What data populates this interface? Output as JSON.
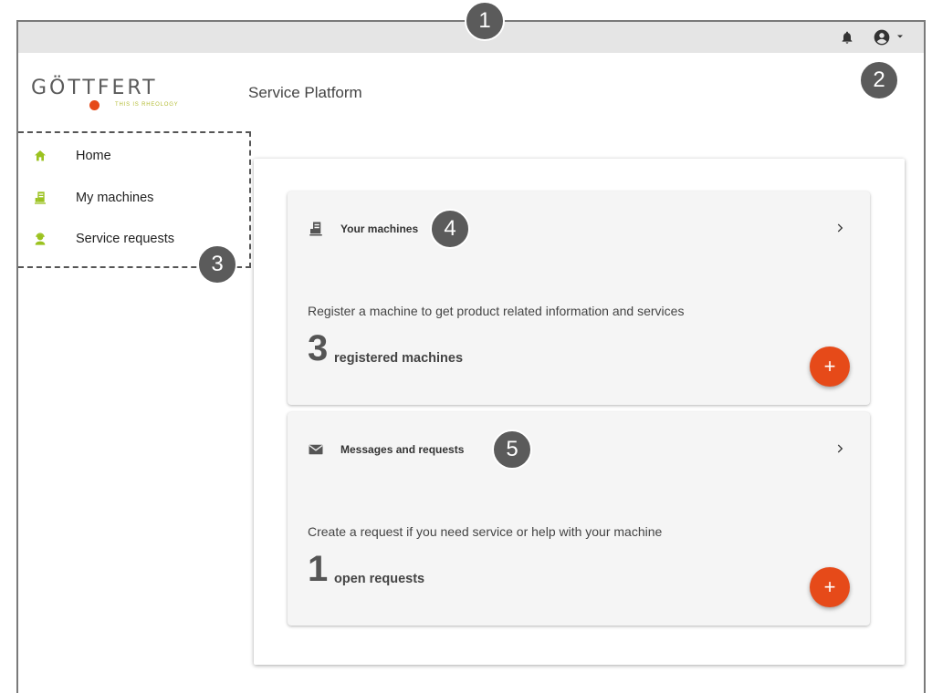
{
  "app": {
    "logo_text": "GÖTTFERT",
    "logo_tagline": "THIS IS RHEOLOGY",
    "title": "Service Platform"
  },
  "topbar": {
    "notification_icon": "bell-icon",
    "account_icon": "account-circle-icon",
    "menu_icon": "caret-down-icon"
  },
  "sidebar": {
    "items": [
      {
        "label": "Home",
        "icon": "home-icon"
      },
      {
        "label": "My machines",
        "icon": "machine-icon"
      },
      {
        "label": "Service requests",
        "icon": "support-agent-icon"
      }
    ]
  },
  "cards": [
    {
      "title": "Your machines",
      "icon": "machine-icon",
      "description": "Register a machine to get product related information and services",
      "count": "3",
      "count_label": "registered machines",
      "action_label": "+"
    },
    {
      "title": "Messages and requests",
      "icon": "envelope-icon",
      "description": "Create a request if you need service or help with your machine",
      "count": "1",
      "count_label": "open requests",
      "action_label": "+"
    }
  ],
  "callouts": [
    "1",
    "2",
    "3",
    "4",
    "5"
  ],
  "colors": {
    "accent": "#e64a19",
    "nav_icon": "#9bc21f",
    "tagline": "#b6be3a"
  }
}
